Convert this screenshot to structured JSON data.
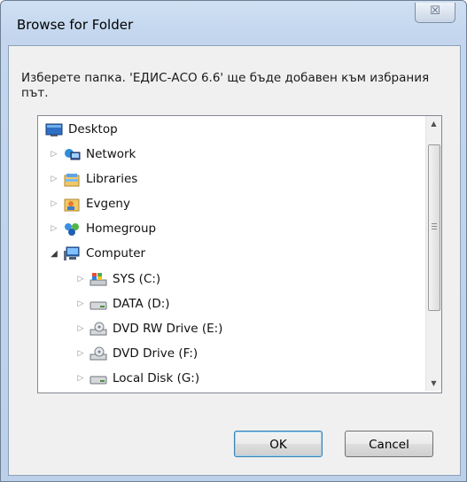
{
  "window": {
    "title": "Browse for Folder",
    "close_glyph": "☒"
  },
  "prompt": "Изберете папка. 'ЕДИС-АСО 6.6' ще бъде добавен към избрания път.",
  "tree": {
    "items": [
      {
        "label": "Desktop",
        "icon": "desktop-icon",
        "expander": ""
      },
      {
        "label": "Network",
        "icon": "network-icon",
        "expander": "▷"
      },
      {
        "label": "Libraries",
        "icon": "libraries-icon",
        "expander": "▷"
      },
      {
        "label": "Evgeny",
        "icon": "user-folder-icon",
        "expander": "▷"
      },
      {
        "label": "Homegroup",
        "icon": "homegroup-icon",
        "expander": "▷"
      },
      {
        "label": "Computer",
        "icon": "computer-icon",
        "expander": "◢"
      },
      {
        "label": "SYS (C:)",
        "icon": "system-drive-icon",
        "expander": "▷"
      },
      {
        "label": "DATA (D:)",
        "icon": "hard-drive-icon",
        "expander": "▷"
      },
      {
        "label": "DVD RW Drive (E:)",
        "icon": "dvd-drive-icon",
        "expander": "▷"
      },
      {
        "label": "DVD Drive (F:)",
        "icon": "dvd-drive-icon",
        "expander": "▷"
      },
      {
        "label": "Local Disk (G:)",
        "icon": "hard-drive-icon",
        "expander": "▷"
      }
    ]
  },
  "buttons": {
    "ok": "OK",
    "cancel": "Cancel"
  },
  "colors": {
    "frame": "#c3d6ee",
    "client": "#f0f0f0",
    "default_button_border": "#3c7fb1"
  }
}
